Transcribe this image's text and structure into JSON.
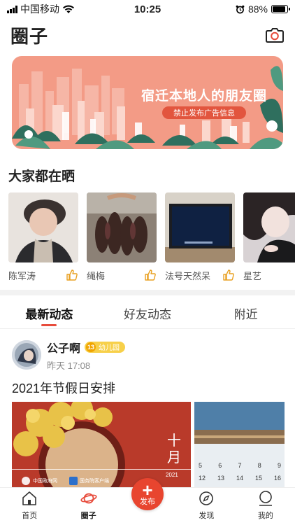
{
  "status_bar": {
    "carrier": "中国移动",
    "time": "10:25",
    "battery": "88%",
    "battery_level": 0.88
  },
  "header": {
    "title": "圈子",
    "camera_icon": "camera-icon"
  },
  "banner": {
    "title": "宿迁本地人的朋友圈",
    "subtitle": "禁止发布广告信息",
    "colors": {
      "background": "#f39b86",
      "pill": "#e2553e"
    }
  },
  "showcase": {
    "heading": "大家都在晒",
    "items": [
      {
        "caption": "陈军涛",
        "icon": "thumbs-up-icon"
      },
      {
        "caption": "绳梅",
        "icon": "thumbs-up-icon"
      },
      {
        "caption": "法号天然呆",
        "icon": "thumbs-up-icon"
      },
      {
        "caption": "星艺",
        "icon": "thumbs-up-icon"
      }
    ]
  },
  "tabs": [
    {
      "label": "最新动态",
      "active": true
    },
    {
      "label": "好友动态",
      "active": false
    },
    {
      "label": "附近",
      "active": false
    }
  ],
  "post": {
    "author": "公子啊",
    "level_number": "13",
    "level_label": "幼儿园",
    "time": "昨天 17:08",
    "title": "2021年节假日安排",
    "image1": {
      "month_top": "十",
      "month_bottom": "月",
      "year": "2021",
      "source1": "中国政府网",
      "source2": "国务院客户端"
    },
    "image2": {
      "calendar_row1": [
        "5",
        "6",
        "7",
        "8",
        "9"
      ],
      "calendar_row2": [
        "12",
        "13",
        "14",
        "15",
        "16"
      ]
    }
  },
  "bottom_nav": [
    {
      "label": "首页",
      "icon": "home-icon",
      "active": false
    },
    {
      "label": "圈子",
      "icon": "planet-icon",
      "active": true
    },
    {
      "label": "发布",
      "icon": "plus-icon",
      "active": false
    },
    {
      "label": "发现",
      "icon": "compass-icon",
      "active": false
    },
    {
      "label": "我的",
      "icon": "user-icon",
      "active": false
    }
  ],
  "colors": {
    "accent": "#e74c3c",
    "badge": "#f7d04a"
  }
}
